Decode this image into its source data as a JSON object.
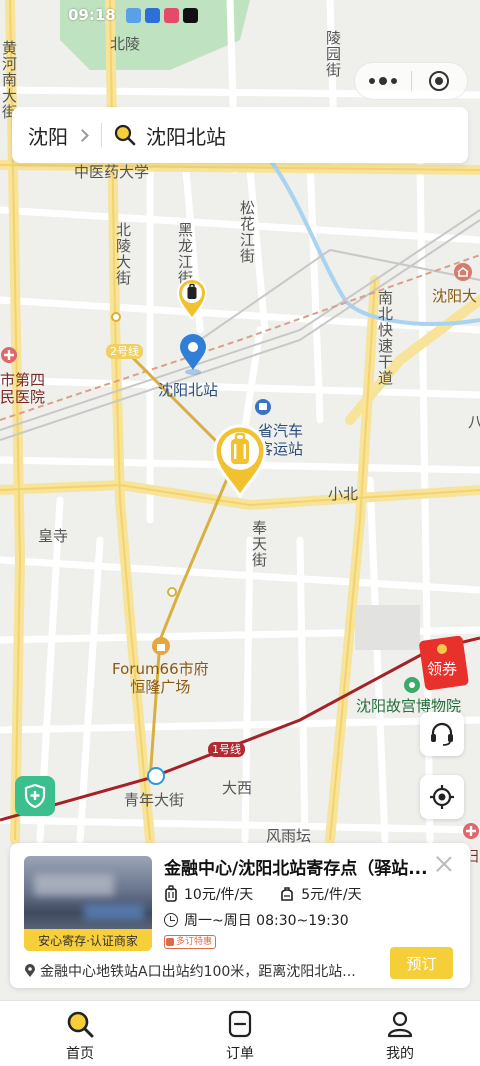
{
  "status_bar": {
    "time": "09:18"
  },
  "search": {
    "city": "沈阳",
    "query": "沈阳北站"
  },
  "map": {
    "labels": {
      "beiling": "北陵",
      "huanghe_nan_dajie": "黄河南大街",
      "lingyuan_jie": "陵园街",
      "zhongyiyao_daxue": "中医药大学",
      "beiling_dajie": "北陵大街",
      "heilongjiang_jie": "黑龙江街",
      "songhuajiang_jie": "松花江街",
      "nanbei_kuaisu_gandao": "南北快速干道",
      "shenyang_da": "沈阳大",
      "line2": "2号线",
      "shenyang_beizhan": "沈阳北站",
      "shi_disi_renmin_yiyuan": "市第四\n民医院",
      "qiche_keyunzhan": "省汽车\n客运站",
      "xiaobei": "小北",
      "huangsi": "皇寺",
      "fengtian_jie": "奉天街",
      "forum66": "Forum66市府\n恒隆广场",
      "palace_museum": "沈阳故宫博物院",
      "line1": "1号线",
      "daxi": "大西",
      "qingnian_dajie": "青年大街",
      "fengyutan": "风雨坛",
      "fu": "妇",
      "ba": "八"
    },
    "coupon_label": "领券"
  },
  "card": {
    "title": "金融中心/沈阳北站寄存点（驿站...",
    "badge": "安心寄存·认证商家",
    "price_large": "10元/件/天",
    "price_small": "5元/件/天",
    "hours": "周一~周日 08:30~19:30",
    "promo": "多订特惠",
    "address": "金融中心地铁站A口出站约100米，距离沈阳北站...",
    "book_label": "预订"
  },
  "tabbar": {
    "tabs": [
      {
        "label": "首页",
        "icon": "search-icon"
      },
      {
        "label": "订单",
        "icon": "order-icon"
      },
      {
        "label": "我的",
        "icon": "profile-icon"
      }
    ]
  },
  "colors": {
    "accent": "#f4cf3a",
    "marker": "#f2c12e",
    "location_blue": "#2f7fd6",
    "metro_line1": "#a32228",
    "shield_green": "#3bbf8f",
    "coupon_red": "#e8312b"
  }
}
